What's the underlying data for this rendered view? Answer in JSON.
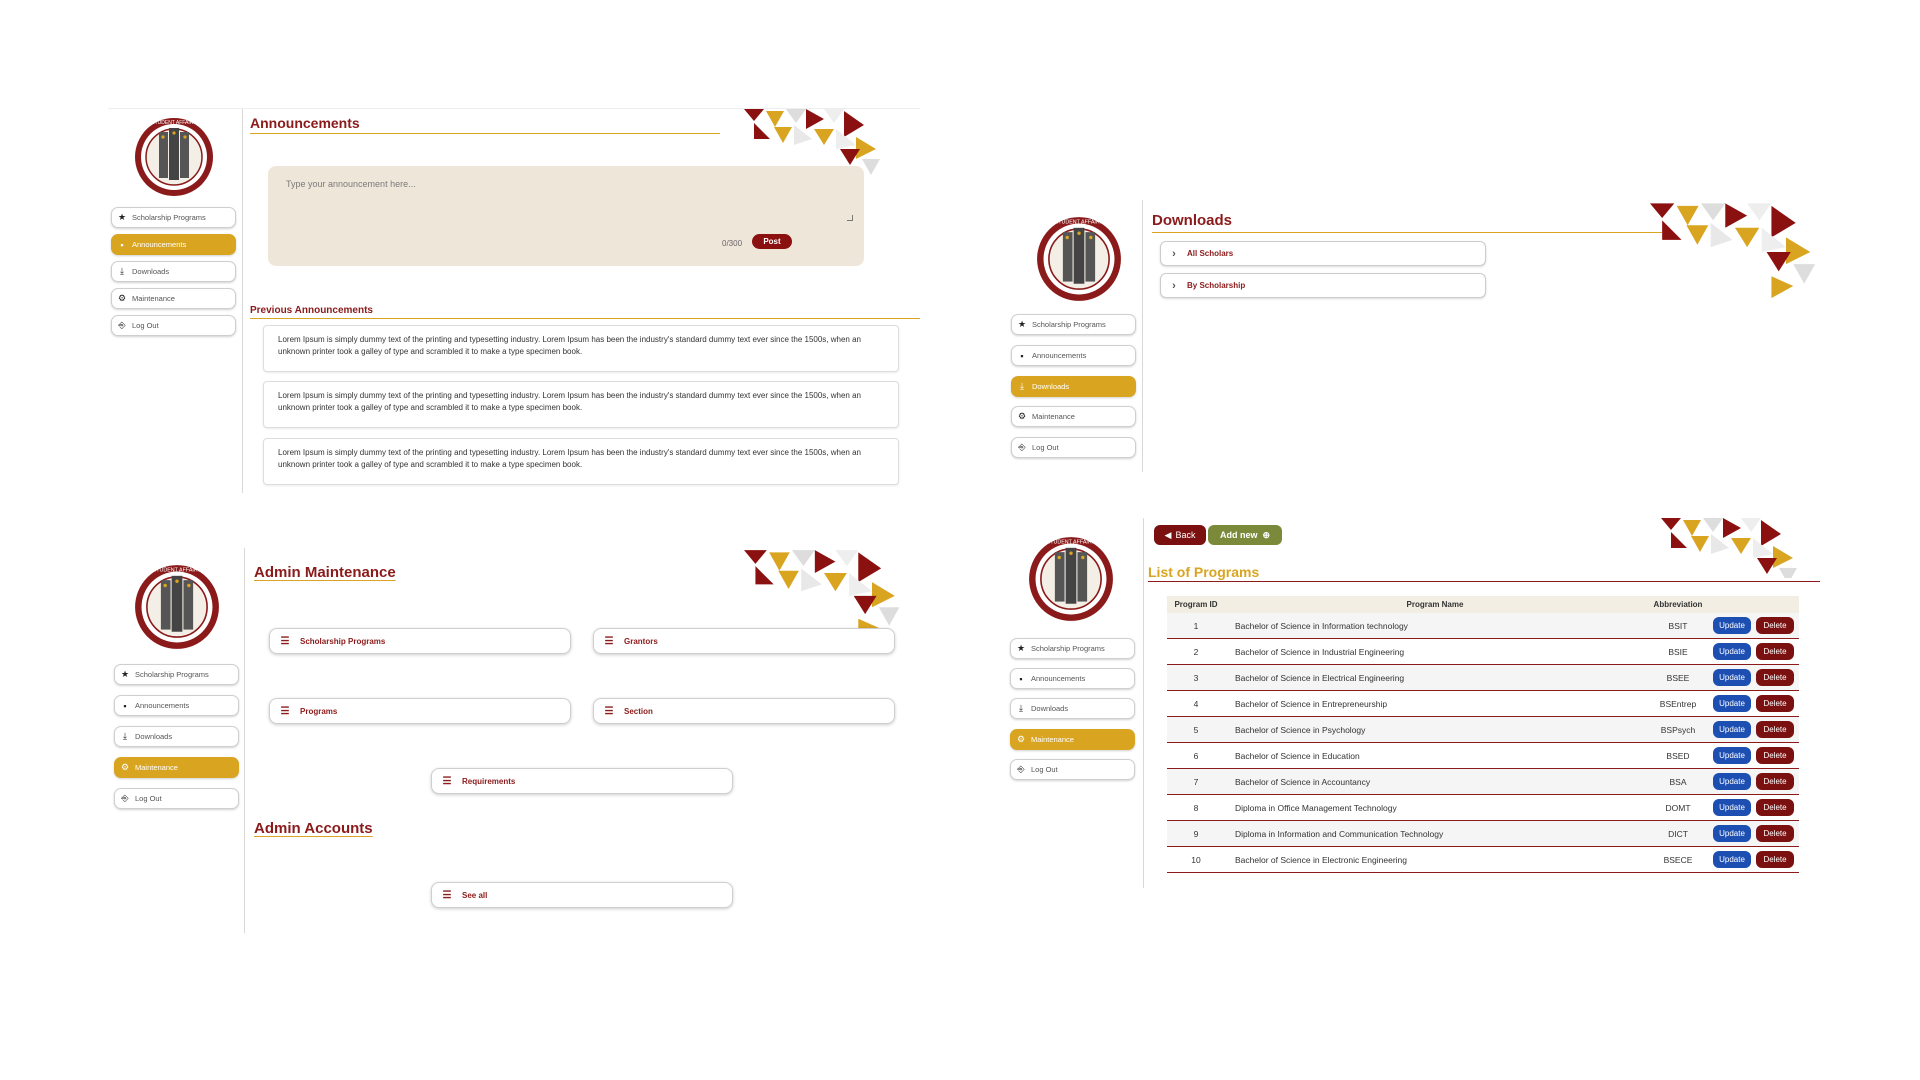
{
  "sidebar": {
    "items": [
      {
        "label": "Scholarship Programs",
        "icon": "star-icon"
      },
      {
        "label": "Announcements",
        "icon": "note-icon"
      },
      {
        "label": "Downloads",
        "icon": "download-icon"
      },
      {
        "label": "Maintenance",
        "icon": "gears-icon"
      },
      {
        "label": "Log Out",
        "icon": "door-icon"
      }
    ]
  },
  "announcements_view": {
    "title": "Announcements",
    "placeholder": "Type your announcement here...",
    "char_count": "0/300",
    "post_label": "Post",
    "previous_title": "Previous Announcements",
    "items": [
      "Lorem Ipsum is simply dummy text of the printing and typesetting industry. Lorem Ipsum has been the industry's standard dummy text ever since the 1500s, when an unknown printer took a galley of type and scrambled it to make a type specimen book.",
      "Lorem Ipsum is simply dummy text of the printing and typesetting industry. Lorem Ipsum has been the industry's standard dummy text ever since the 1500s, when an unknown printer took a galley of type and scrambled it to make a type specimen book.",
      "Lorem Ipsum is simply dummy text of the printing and typesetting industry. Lorem Ipsum has been the industry's standard dummy text ever since the 1500s, when an unknown printer took a galley of type and scrambled it to make a type specimen book."
    ]
  },
  "downloads_view": {
    "title": "Downloads",
    "items": [
      "All Scholars",
      "By Scholarship"
    ]
  },
  "maintenance_view": {
    "title": "Admin Maintenance",
    "buttons": [
      "Scholarship Programs",
      "Grantors",
      "Programs",
      "Section",
      "Requirements"
    ],
    "accounts_title": "Admin Accounts",
    "see_all_label": "See all"
  },
  "programs_view": {
    "back_label": "Back",
    "add_label": "Add new",
    "title": "List of Programs",
    "columns": [
      "Program ID",
      "Program Name",
      "Abbreviation"
    ],
    "update_label": "Update",
    "delete_label": "Delete",
    "rows": [
      {
        "id": "1",
        "name": "Bachelor of Science in Information technology",
        "abbr": "BSIT"
      },
      {
        "id": "2",
        "name": "Bachelor of Science in Industrial Engineering",
        "abbr": "BSIE"
      },
      {
        "id": "3",
        "name": "Bachelor of Science in Electrical Engineering",
        "abbr": "BSEE"
      },
      {
        "id": "4",
        "name": "Bachelor of Science in Entrepreneurship",
        "abbr": "BSEntrep"
      },
      {
        "id": "5",
        "name": "Bachelor of Science in Psychology",
        "abbr": "BSPsych"
      },
      {
        "id": "6",
        "name": "Bachelor of Science in Education",
        "abbr": "BSED"
      },
      {
        "id": "7",
        "name": "Bachelor of Science in Accountancy",
        "abbr": "BSA"
      },
      {
        "id": "8",
        "name": "Diploma in Office Management Technology",
        "abbr": "DOMT"
      },
      {
        "id": "9",
        "name": "Diploma in Information and Communication Technology",
        "abbr": "DICT"
      },
      {
        "id": "10",
        "name": "Bachelor of Science in Electronic Engineering",
        "abbr": "BSECE"
      }
    ]
  },
  "colors": {
    "maroon": "#8b1a1a",
    "gold": "#d9a521",
    "update_blue": "#1d4fb3",
    "add_green": "#7a8a3a"
  }
}
